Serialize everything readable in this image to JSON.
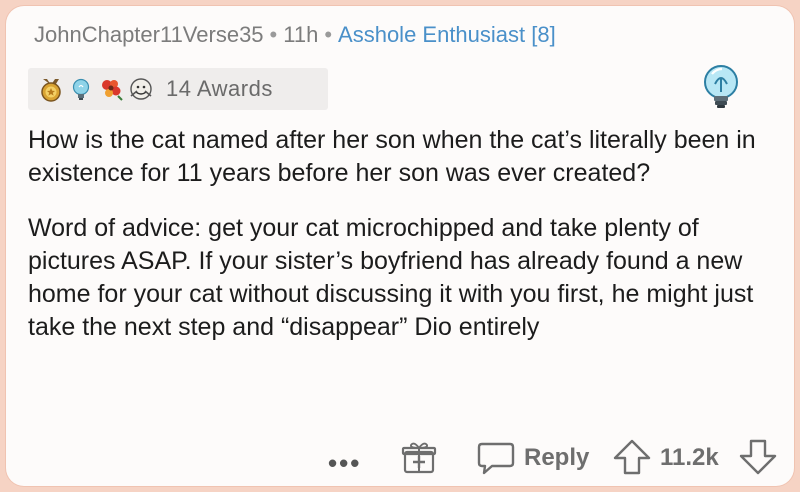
{
  "comment": {
    "username": "JohnChapter11Verse35",
    "separator": "•",
    "time_ago": "11h",
    "flair": "Asshole Enthusiast [8]",
    "awards_label": "14 Awards",
    "awards_icons": [
      "gold-medal-icon",
      "lightbulb-icon",
      "flower-award-icon",
      "hug-award-icon"
    ],
    "paragraphs": [
      "How is the cat named after her son when the cat’s literally been in existence for 11 years before her son was ever created?",
      "Word of advice: get your cat microchipped and take plenty of pictures ASAP. If your sister’s boyfriend has already found a new home for your cat without discussing it with you first, he might just take the next step and “disappear” Dio entirely"
    ]
  },
  "actions": {
    "more_label": "•••",
    "reply_label": "Reply",
    "score": "11.2k"
  },
  "colors": {
    "flair": "#4a90c9",
    "meta": "#7c7c7c",
    "action": "#6e6e6e",
    "frame_border": "#f0c3b1"
  }
}
